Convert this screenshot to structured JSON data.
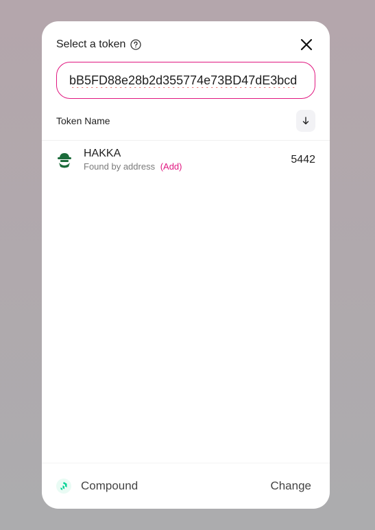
{
  "header": {
    "title": "Select a token",
    "help_icon": "question-circle-icon",
    "close_icon": "close-icon"
  },
  "search": {
    "value": "bB5FD88e28b2d355774e73BD47dE3bcd",
    "border_color": "#e0157f"
  },
  "list_header": {
    "column_label": "Token Name",
    "sort_icon": "arrow-down-icon"
  },
  "tokens": [
    {
      "symbol": "HAKKA",
      "subtitle": "Found by address",
      "add_label": "(Add)",
      "balance": "5442",
      "logo_icon": "hakka-logo-icon"
    }
  ],
  "footer": {
    "list_name": "Compound",
    "list_icon": "compound-logo-icon",
    "change_label": "Change"
  },
  "colors": {
    "accent": "#e0157f",
    "compound": "#00d395",
    "hakka": "#1b6b3a"
  }
}
